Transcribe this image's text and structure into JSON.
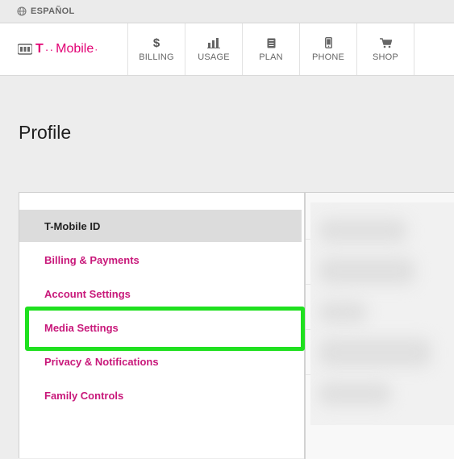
{
  "topbar": {
    "language_label": "ESPAÑOL",
    "language_icon": "globe-icon"
  },
  "logo": {
    "brand": "T-Mobile",
    "t_letter": "T",
    "dots": "··",
    "word": "Mobile",
    "end": "·"
  },
  "nav": {
    "items": [
      {
        "label": "BILLING",
        "icon": "dollar-icon",
        "glyph": "$"
      },
      {
        "label": "USAGE",
        "icon": "bar-chart-icon"
      },
      {
        "label": "PLAN",
        "icon": "document-icon"
      },
      {
        "label": "PHONE",
        "icon": "phone-icon"
      },
      {
        "label": "SHOP",
        "icon": "cart-icon"
      }
    ]
  },
  "page": {
    "title": "Profile"
  },
  "sidebar": {
    "items": [
      {
        "label": "T-Mobile ID",
        "active": true
      },
      {
        "label": "Billing & Payments"
      },
      {
        "label": "Account Settings"
      },
      {
        "label": "Media Settings",
        "highlighted": true
      },
      {
        "label": "Privacy & Notifications"
      },
      {
        "label": "Family Controls"
      }
    ]
  },
  "colors": {
    "brand": "#e20074",
    "link": "#c8187a",
    "highlight": "#1fe01f"
  }
}
